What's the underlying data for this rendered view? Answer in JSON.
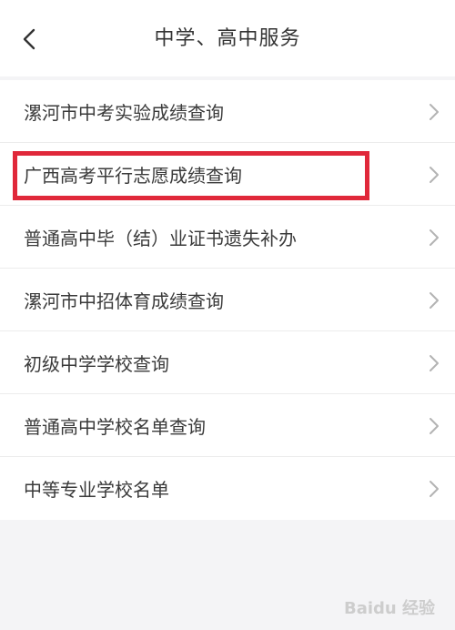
{
  "header": {
    "title": "中学、高中服务",
    "back_icon": "chevron-left-icon"
  },
  "menu": {
    "items": [
      {
        "label": "漯河市中考实验成绩查询",
        "icon": "chevron-right-icon"
      },
      {
        "label": "广西高考平行志愿成绩查询",
        "icon": "chevron-right-icon",
        "highlighted": true
      },
      {
        "label": "普通高中毕（结）业证书遗失补办",
        "icon": "chevron-right-icon"
      },
      {
        "label": "漯河市中招体育成绩查询",
        "icon": "chevron-right-icon"
      },
      {
        "label": "初级中学学校查询",
        "icon": "chevron-right-icon"
      },
      {
        "label": "普通高中学校名单查询",
        "icon": "chevron-right-icon"
      },
      {
        "label": "中等专业学校名单",
        "icon": "chevron-right-icon"
      }
    ]
  },
  "colors": {
    "highlight_border": "#e0283a",
    "background": "#f4f4f6",
    "text": "#3a3a3a"
  },
  "watermark": "Baidu 经验"
}
